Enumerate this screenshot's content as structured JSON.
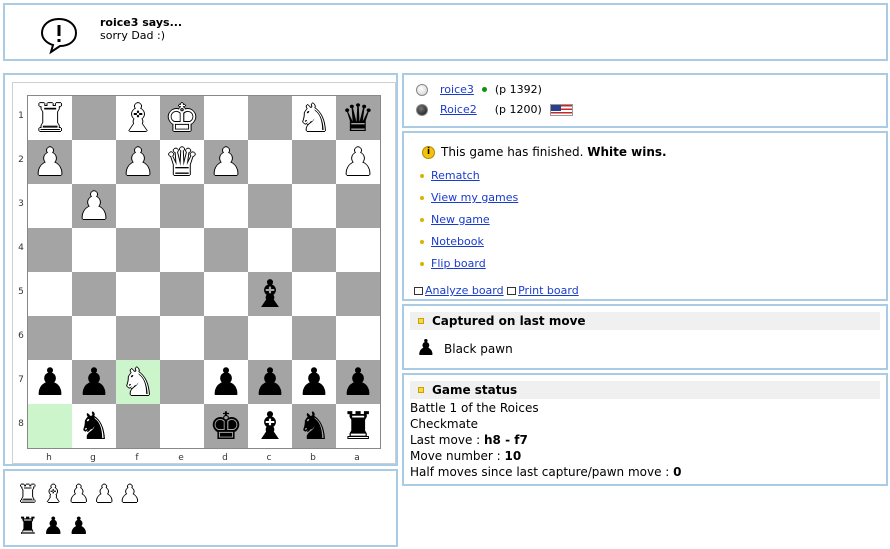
{
  "chat": {
    "speaker": "roice3 says...",
    "message": "sorry Dad :)",
    "icon": "speech-bubble-exclamation-icon"
  },
  "board": {
    "ranks": [
      "1",
      "2",
      "3",
      "4",
      "5",
      "6",
      "7",
      "8"
    ],
    "files": [
      "h",
      "g",
      "f",
      "e",
      "d",
      "c",
      "b",
      "a"
    ],
    "highlight_squares": [
      "f7",
      "h8"
    ],
    "rows": [
      [
        "wR",
        "",
        "wB",
        "wK",
        "",
        "",
        "wN",
        "bQ"
      ],
      [
        "wP",
        "",
        "wP",
        "wQ",
        "wP",
        "",
        "",
        "wP"
      ],
      [
        "",
        "wP",
        "",
        "",
        "",
        "",
        "",
        ""
      ],
      [
        "",
        "",
        "",
        "",
        "",
        "",
        "",
        ""
      ],
      [
        "",
        "",
        "",
        "",
        "",
        "bB",
        "",
        ""
      ],
      [
        "",
        "",
        "",
        "",
        "",
        "",
        "",
        ""
      ],
      [
        "bP",
        "bP",
        "wN",
        "",
        "bP",
        "bP",
        "bP",
        "bP"
      ],
      [
        "",
        "bN",
        "",
        "",
        "bK",
        "bB",
        "bN",
        "bR"
      ]
    ]
  },
  "captured_pieces": {
    "white": [
      "wR",
      "wB",
      "wP",
      "wP",
      "wP"
    ],
    "black": [
      "bR",
      "bP",
      "bP"
    ]
  },
  "players": [
    {
      "name": "roice3",
      "rating": "(p 1392)",
      "online": true,
      "color": "white"
    },
    {
      "name": "Roice2",
      "rating": "(p 1200)",
      "flag": "us-flag-icon",
      "color": "black"
    }
  ],
  "actions": {
    "info_text": "This game has finished.",
    "info_result": "White wins.",
    "links": [
      "Rematch",
      "View my games",
      "New game",
      "Notebook",
      "Flip board"
    ],
    "analyze": "Analyze board",
    "print": "Print board"
  },
  "last_capture": {
    "title": "Captured on last move",
    "piece": "Black pawn"
  },
  "game_status": {
    "title": "Game status",
    "name": "Battle 1 of the Roices",
    "result": "Checkmate",
    "last_move_label": "Last move :",
    "last_move_value": "h8 - f7",
    "move_number_label": "Move number :",
    "move_number_value": "10",
    "half_moves_label": "Half moves since last capture/pawn move :",
    "half_moves_value": "0"
  },
  "colors": {
    "panel_border": "#a9cbe4",
    "dark_square": "#a4a4a4",
    "highlight_square": "#ccf5cc",
    "link": "#1a3ccc"
  }
}
